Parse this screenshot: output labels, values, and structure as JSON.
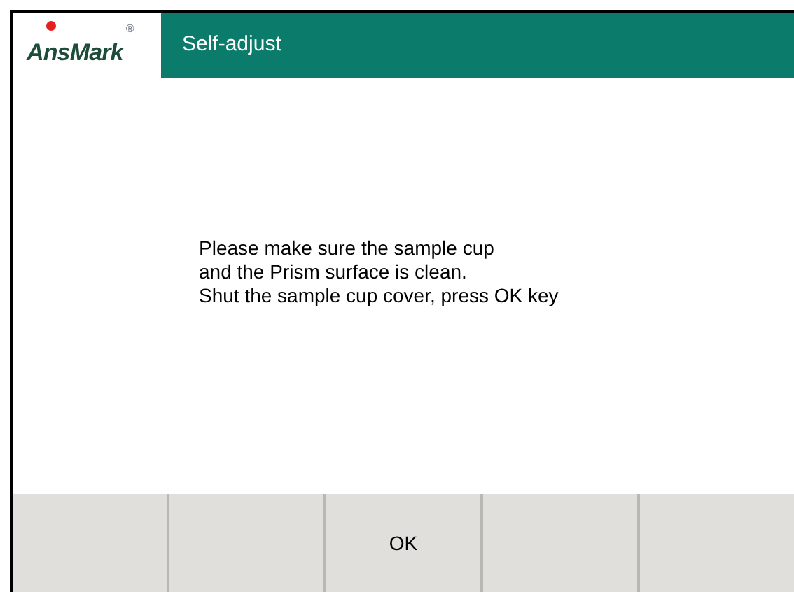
{
  "logo": {
    "text": "AnsMark",
    "mark": "®"
  },
  "window": {
    "title": "Self-adjust"
  },
  "message": [
    "Please make sure the sample cup",
    "and the Prism surface is clean.",
    "Shut the sample cup cover, press OK key"
  ],
  "softkeys": [
    {
      "kind": "blank"
    },
    {
      "kind": "blank"
    },
    {
      "kind": "key",
      "label": "OK"
    },
    {
      "kind": "blank"
    },
    {
      "kind": "blank"
    }
  ]
}
